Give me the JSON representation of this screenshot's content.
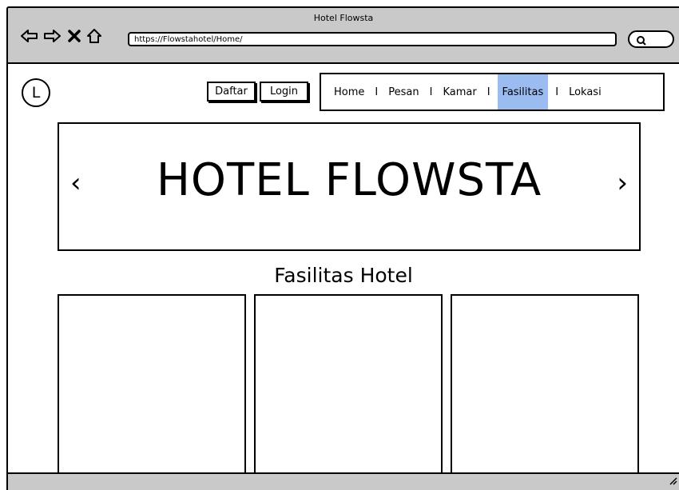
{
  "window": {
    "title": "Hotel Flowsta"
  },
  "browser": {
    "url": "https://Flowstahotel/Home/",
    "icons": [
      "back-arrow-icon",
      "forward-arrow-icon",
      "close-icon",
      "home-icon",
      "search-icon"
    ]
  },
  "header": {
    "logo_letter": "L",
    "register_label": "Daftar",
    "login_label": "Login"
  },
  "nav": {
    "items": [
      "Home",
      "Pesan",
      "Kamar",
      "Fasilitas",
      "Lokasi"
    ],
    "separator": "I",
    "active": "Fasilitas",
    "active_color": "#9bbcf0"
  },
  "hero": {
    "title": "HOTEL FLOWSTA",
    "prev": "‹",
    "next": "›"
  },
  "facilities": {
    "title": "Fasilitas Hotel",
    "cards": 3
  },
  "colors": {
    "chrome": "#c9c9c9",
    "accent": "#9bbcf0"
  }
}
